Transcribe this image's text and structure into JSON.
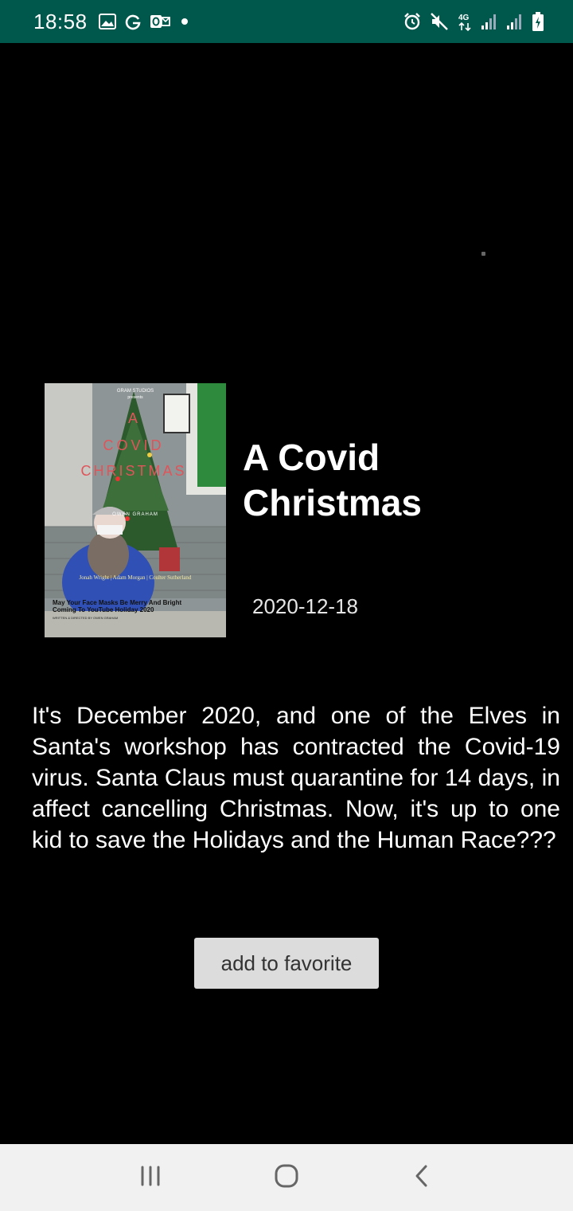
{
  "status_bar": {
    "time": "18:58",
    "network_label": "4G",
    "left_icons": [
      "gallery-icon",
      "google-icon",
      "outlook-icon",
      "dot-icon"
    ],
    "right_icons": [
      "alarm-icon",
      "mute-icon",
      "network-4g-icon",
      "signal-icon",
      "signal-icon",
      "battery-icon"
    ],
    "color": "#00574b"
  },
  "movie": {
    "title": "A Covid Christmas",
    "release_date": "2020-12-18",
    "overview": "It's December 2020, and one of the Elves in Santa's workshop has contracted the Covid-19 virus.  Santa Claus must quarantine for 14 days, in affect cancelling Christmas. Now, it's up to one kid to save the Holidays and the Human Race???",
    "poster": {
      "studio": "GRAM STUDIOS",
      "presents": "presents",
      "title_words": [
        "A",
        "COVID",
        "CHRISTMAS"
      ],
      "director": "OWEN GRAHAM",
      "cast": "Jonah Wright | Adam Morgan | Coulter Sutherland",
      "tagline_1": "May Your Face Masks Be Merry And Bright",
      "tagline_2": "Coming To YouTube Holiday 2020",
      "credit": "WRITTEN & DIRECTED BY OWEN GRAHAM"
    }
  },
  "actions": {
    "favorite_label": "add to favorite"
  },
  "nav_bar": {
    "buttons": [
      "recent-apps-icon",
      "home-icon",
      "back-icon"
    ]
  }
}
